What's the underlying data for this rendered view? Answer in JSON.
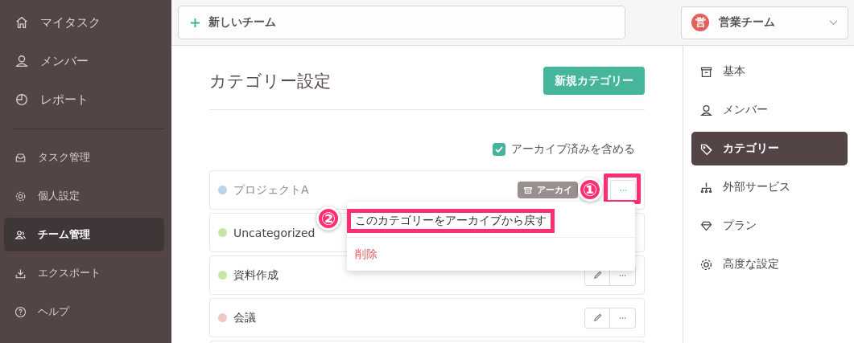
{
  "sidebar": {
    "primary": [
      {
        "label": "マイタスク",
        "selected": false
      },
      {
        "label": "メンバー",
        "selected": false
      },
      {
        "label": "レポート",
        "selected": false
      }
    ],
    "secondary": [
      {
        "label": "タスク管理",
        "selected": false
      },
      {
        "label": "個人設定",
        "selected": false
      },
      {
        "label": "チーム管理",
        "selected": true
      },
      {
        "label": "エクスポート",
        "selected": false
      },
      {
        "label": "ヘルプ",
        "selected": false
      }
    ]
  },
  "topbar": {
    "new_team": "新しいチーム",
    "team": {
      "avatar": "営",
      "name": "営業チーム"
    }
  },
  "page": {
    "title": "カテゴリー設定",
    "new_category": "新規カテゴリー",
    "include_archived": {
      "label": "アーカイブ済みを含める",
      "checked": true
    }
  },
  "categories": [
    {
      "name": "プロジェクトA",
      "color": "#b9d5f0",
      "archived": true,
      "badge": "アーカイ",
      "menu_open": true
    },
    {
      "name": "Uncategorized",
      "color": "#c5e6a6",
      "archived": false,
      "menu_open": false
    },
    {
      "name": "資料作成",
      "color": "#c5e6a6",
      "archived": false,
      "menu_open": false
    },
    {
      "name": "会議",
      "color": "#f5c6c6",
      "archived": false,
      "menu_open": false
    }
  ],
  "menu": [
    {
      "label": "このカテゴリーをアーカイブから戻す",
      "kind": "normal",
      "highlighted": true
    },
    {
      "label": "削除",
      "kind": "danger",
      "highlighted": false
    }
  ],
  "annotations": [
    {
      "label": "①"
    },
    {
      "label": "②"
    }
  ],
  "settings_nav": [
    {
      "label": "基本",
      "selected": false
    },
    {
      "label": "メンバー",
      "selected": false
    },
    {
      "label": "カテゴリー",
      "selected": true
    },
    {
      "label": "外部サービス",
      "selected": false
    },
    {
      "label": "プラン",
      "selected": false
    },
    {
      "label": "高度な設定",
      "selected": false
    }
  ]
}
